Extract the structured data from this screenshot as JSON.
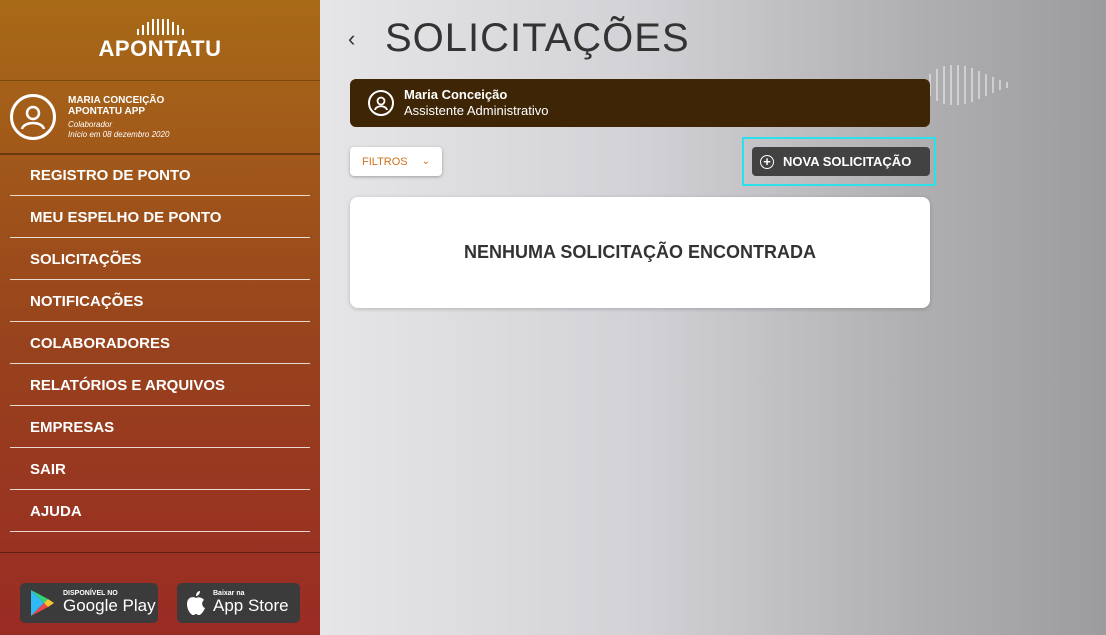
{
  "brand": {
    "name": "APONTATU"
  },
  "profile": {
    "name": "MARIA CONCEIçãO",
    "company": "APONTATU APP",
    "role": "Colaborador",
    "since": "Início em 08 dezembro 2020"
  },
  "menu": [
    {
      "label": "REGISTRO DE PONTO"
    },
    {
      "label": "MEU ESPELHO DE PONTO"
    },
    {
      "label": "SOLICITAÇÕES"
    },
    {
      "label": "NOTIFICAÇÕES"
    },
    {
      "label": "COLABORADORES"
    },
    {
      "label": "RELATÓRIOS E ARQUIVOS"
    },
    {
      "label": "EMPRESAS"
    },
    {
      "label": "SAIR"
    },
    {
      "label": "AJUDA"
    }
  ],
  "stores": {
    "google": {
      "small": "DISPONÍVEL NO",
      "big": "Google Play"
    },
    "apple": {
      "small": "Baixar na",
      "big": "App Store"
    }
  },
  "header": {
    "back_icon": "‹",
    "title": "SOLICITAÇÕES"
  },
  "user_bar": {
    "name": "Maria Conceição",
    "role": "Assistente Administrativo"
  },
  "filters": {
    "label": "FILTROS",
    "chevron": "⌄"
  },
  "new_request": {
    "icon": "+",
    "label": "NOVA SOLICITAÇÃO"
  },
  "empty_state": {
    "message": "NENHUMA SOLICITAÇÃO ENCONTRADA"
  },
  "colors": {
    "sidebar_top": "#a86a17",
    "sidebar_bottom": "#9a2b24",
    "user_bar": "#3d2506",
    "accent_orange": "#d2711c",
    "highlight": "#2ce1e9",
    "dark_button": "#424242"
  }
}
